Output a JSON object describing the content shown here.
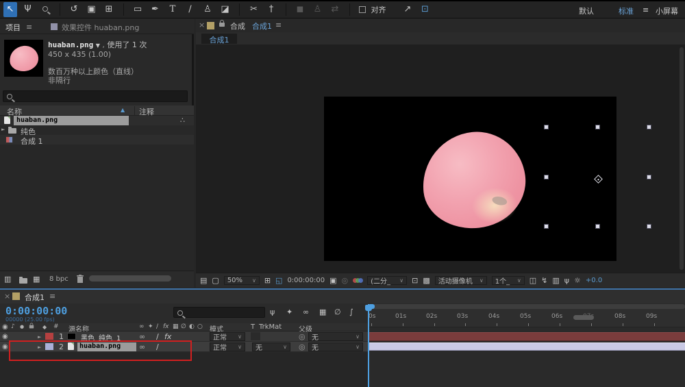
{
  "icons": {
    "menu": "≡",
    "close": "×",
    "chevron": "∨",
    "expand": "►",
    "tri_down": "▼",
    "eye": "◉",
    "audio": "♪",
    "solo": "●",
    "label_col": "◆",
    "hash": "#",
    "sort_asc": "▲",
    "network": "∴",
    "comma": ",",
    "shy": "∞",
    "collapse_tr": "✦",
    "quality": "∕",
    "fx": "fx",
    "frame_blend": "▦",
    "motion_blur": "∅",
    "adjustment": "◐",
    "threed": "○",
    "switches_col": "⊙",
    "pickwhip": "◎",
    "panels": "▤",
    "monitor": "▢",
    "grid": "⊞",
    "roi": "◱",
    "camera": "▣",
    "snapshot_show": "◎",
    "target": "⊡",
    "transp_grid": "▩",
    "pixel_aspect": "◫",
    "fast_preview": "↯",
    "tl_button": "▥",
    "flowchart": "ψ",
    "exposure_reset": "☼",
    "mini_flowchart": "ψ",
    "draft3d": "✦",
    "hide_shy": "∞",
    "graph": "∫",
    "interpret": "▥",
    "newcomp": "▦"
  },
  "toolbar": {
    "tools": [
      {
        "name": "selection-tool",
        "glyph": "↖"
      },
      {
        "name": "hand-tool",
        "glyph": "Ψ"
      },
      {
        "name": "zoom-tool",
        "glyph": ""
      },
      {
        "name": "rotate-tool",
        "glyph": "↺"
      },
      {
        "name": "camera-tool",
        "glyph": "▣"
      },
      {
        "name": "pan-behind-tool",
        "glyph": "⊞"
      },
      {
        "name": "rectangle-tool",
        "glyph": "▭"
      },
      {
        "name": "pen-tool",
        "glyph": "✒"
      },
      {
        "name": "type-tool",
        "glyph": "T"
      },
      {
        "name": "brush-tool",
        "glyph": "∕"
      },
      {
        "name": "clone-stamp-tool",
        "glyph": "♙"
      },
      {
        "name": "eraser-tool",
        "glyph": "◪"
      },
      {
        "name": "roto-brush-tool",
        "glyph": "✂"
      },
      {
        "name": "puppet-pin-tool",
        "glyph": "†"
      }
    ],
    "disabled": [
      "◼",
      "♙",
      "⇄"
    ],
    "align_label": "对齐",
    "extra": [
      {
        "name": "mask-feather-icon",
        "glyph": "↗"
      },
      {
        "name": "snapping-icon",
        "glyph": "⊡"
      }
    ],
    "workspaces": {
      "default": "默认",
      "standard": "标准",
      "small_screen": "小屏幕"
    }
  },
  "project": {
    "tab_project": "项目",
    "tab_effects": "效果控件 huaban.png",
    "info": {
      "filename": "huaban.png",
      "usage": "使用了 1 次",
      "dimensions": "450 x 435 (1.00)",
      "colors": "数百万种以上颜色（直线）",
      "scan": "非隔行"
    },
    "columns": {
      "name": "名称",
      "comment": "注释"
    },
    "rows": [
      {
        "name": "huaban.png"
      },
      {
        "name": "纯色"
      },
      {
        "name": "合成 1"
      }
    ],
    "footer": {
      "bpc": "8 bpc"
    }
  },
  "comp": {
    "panel_label": "合成",
    "comp_name": "合成1",
    "tab": "合成1",
    "toolbar": {
      "zoom": "50%",
      "timecode": "0:00:00:00",
      "resolution": "(二分_",
      "view": "活动摄像机",
      "layout": "1个_",
      "exposure": "+0.0"
    }
  },
  "timeline": {
    "tab": "合成1",
    "timecode": "0:00:00:00",
    "frames": "00000 (25.00 fps)",
    "columns": {
      "source_name": "源名称",
      "mode": "模式",
      "t": "T",
      "trkmat": "TrkMat",
      "parent": "父级"
    },
    "layers": [
      {
        "num": "1",
        "name": "黑色 纯色 1",
        "mode": "正常",
        "parent": "无"
      },
      {
        "num": "2",
        "name": "huaban.png",
        "mode": "正常",
        "trkmat": "无",
        "parent": "无"
      }
    ],
    "ruler": [
      "0s",
      "01s",
      "02s",
      "03s",
      "04s",
      "05s",
      "06s",
      "07s",
      "08s",
      "09s"
    ]
  },
  "colors": {
    "accent_blue": "#4e9fe0",
    "annotation_red": "#d21f1f",
    "layer1_bar": "#7a3c3c",
    "layer2_bar": "#c9c9e4",
    "layer1_label": "#b54040",
    "layer2_label": "#aab0d8"
  }
}
